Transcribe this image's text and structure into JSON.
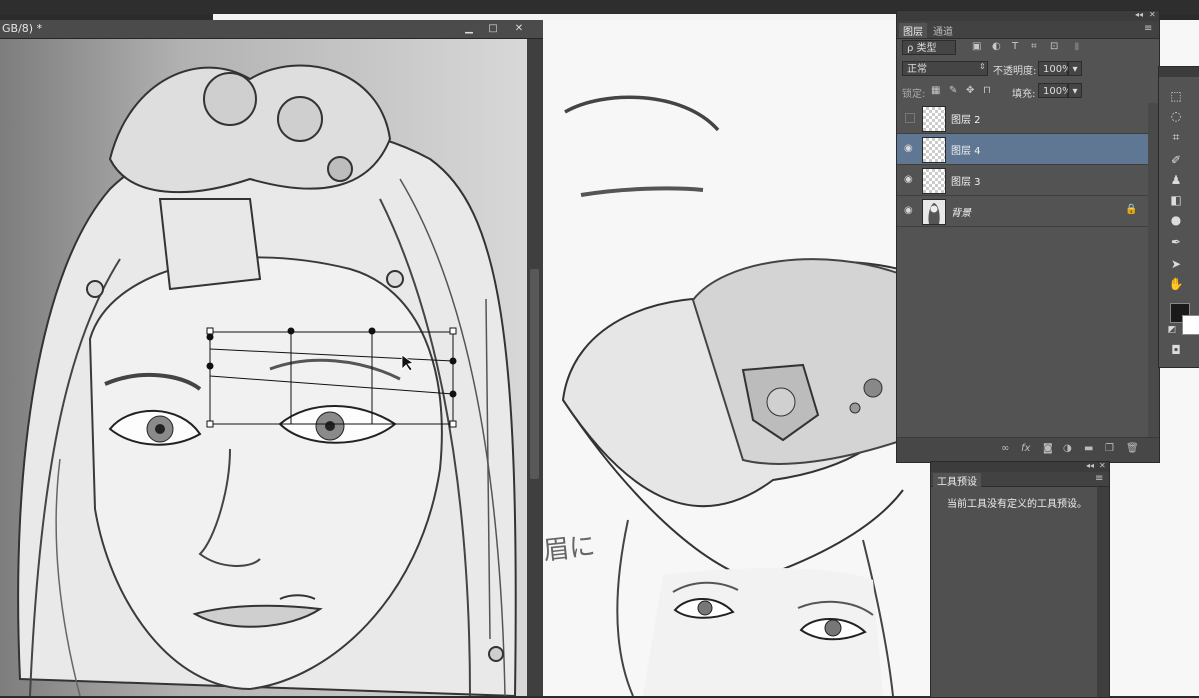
{
  "app": {
    "doc1_title_fragment": "GB/8) *",
    "win_minimize": "▁",
    "win_restore": "□",
    "win_close": "✕"
  },
  "canvas2": {
    "handwritten_note": "眉に"
  },
  "layers_panel": {
    "collapse_glyph": "◂◂",
    "close_glyph": "✕",
    "menu_glyph": "≡",
    "tabs": [
      "图层",
      "通道"
    ],
    "filter_kind": "ρ 类型",
    "blend_mode": "正常",
    "opacity_label": "不透明度:",
    "opacity_value": "100%",
    "lock_label": "锁定:",
    "fill_label": "填充:",
    "fill_value": "100%",
    "layers": [
      {
        "name": "图层 2",
        "visible": false,
        "selected": false,
        "locked": false
      },
      {
        "name": "图层 4",
        "visible": true,
        "selected": true,
        "locked": false
      },
      {
        "name": "图层 3",
        "visible": true,
        "selected": false,
        "locked": false
      },
      {
        "name": "背景",
        "visible": true,
        "selected": false,
        "locked": true
      }
    ],
    "eye_glyph": "◉",
    "lock_glyph": "🔒"
  },
  "tool_presets_panel": {
    "tab": "工具预设",
    "empty_message": "当前工具没有定义的工具预设。",
    "collapse_glyph": "◂◂",
    "close_glyph": "✕",
    "menu_glyph": "≡"
  },
  "colors": {
    "panel_bg": "#535353",
    "selected_layer": "#5f7792",
    "canvas_bg": "#f7f7f7"
  }
}
